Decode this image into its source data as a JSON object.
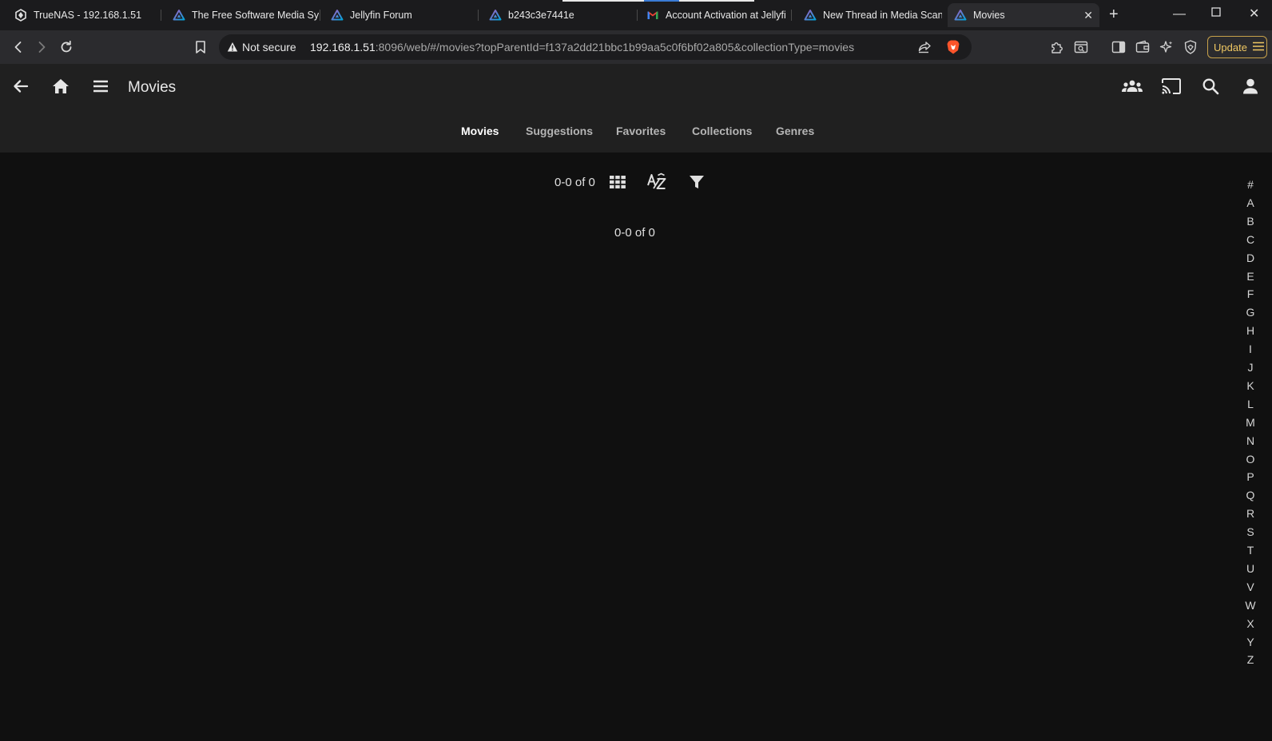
{
  "browser": {
    "tabs": [
      {
        "title": "TrueNAS - 192.168.1.51",
        "icon": "truenas-icon"
      },
      {
        "title": "The Free Software Media Sy",
        "icon": "jellyfin-icon"
      },
      {
        "title": "Jellyfin Forum",
        "icon": "jellyfin-icon"
      },
      {
        "title": "b243c3e7441e",
        "icon": "jellyfin-icon"
      },
      {
        "title": "Account Activation at Jellyfi",
        "icon": "gmail-icon"
      },
      {
        "title": "New Thread in Media Scann",
        "icon": "jellyfin-icon"
      },
      {
        "title": "Movies",
        "icon": "jellyfin-icon"
      }
    ],
    "security_label": "Not secure",
    "url_host": "192.168.1.51",
    "url_rest": ":8096/web/#/movies?topParentId=f137a2dd21bbc1b99aa5c0f6bf02a805&collectionType=movies",
    "update_label": "Update"
  },
  "jellyfin": {
    "page_title": "Movies",
    "tabs": [
      "Movies",
      "Suggestions",
      "Favorites",
      "Collections",
      "Genres"
    ],
    "active_tab": "Movies",
    "count_top": "0-0 of 0",
    "count_middle": "0-0 of 0",
    "alphabet": [
      "#",
      "A",
      "B",
      "C",
      "D",
      "E",
      "F",
      "G",
      "H",
      "I",
      "J",
      "K",
      "L",
      "M",
      "N",
      "O",
      "P",
      "Q",
      "R",
      "S",
      "T",
      "U",
      "V",
      "W",
      "X",
      "Y",
      "Z"
    ]
  },
  "colors": {
    "page_background": "#101010",
    "header_background": "#202020",
    "update_accent": "#f0c862",
    "jellyfin_gradient_start": "#aa5cc3",
    "jellyfin_gradient_end": "#00a4dc"
  }
}
